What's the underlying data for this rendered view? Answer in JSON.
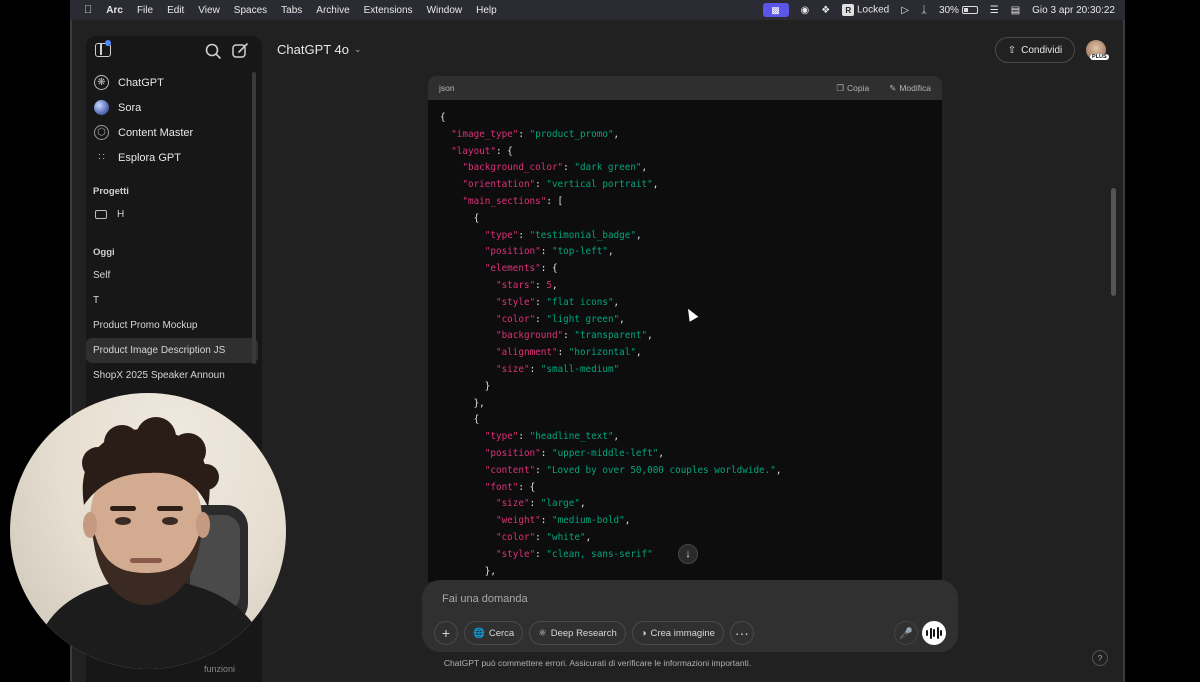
{
  "menubar": {
    "apple": "",
    "app": "Arc",
    "menus": [
      "File",
      "Edit",
      "View",
      "Spaces",
      "Tabs",
      "Archive",
      "Extensions",
      "Window",
      "Help"
    ],
    "status": {
      "locked": "Locked",
      "battery": "30%",
      "datetime": "Gio 3 apr  20:30:22",
      "r_badge": "R"
    }
  },
  "header": {
    "model": "ChatGPT 4o",
    "share": "Condividi",
    "plan_badge": "PLUS"
  },
  "sidebar": {
    "gpts": [
      {
        "label": "ChatGPT",
        "icon": "chatgpt-icon"
      },
      {
        "label": "Sora",
        "icon": "sora-icon"
      },
      {
        "label": "Content Master",
        "icon": "content-master-icon"
      },
      {
        "label": "Esplora GPT",
        "icon": "explore-grid-icon"
      }
    ],
    "projects_heading": "Progetti",
    "projects": [
      {
        "label": "H"
      }
    ],
    "today_heading": "Oggi",
    "chats": [
      {
        "label": "Self"
      },
      {
        "label": "T"
      },
      {
        "label": "Product Promo Mockup"
      },
      {
        "label": "Product Image Description JS"
      },
      {
        "label": "ShopX 2025 Speaker Announ"
      }
    ],
    "footer": "funzioni"
  },
  "code_block": {
    "lang": "json",
    "copy": "Copia",
    "edit": "Modifica",
    "lines": [
      [
        {
          "t": "{",
          "c": "p"
        }
      ],
      [
        {
          "t": "  ",
          "c": "p"
        },
        {
          "t": "\"image_type\"",
          "c": "k"
        },
        {
          "t": ": ",
          "c": "p"
        },
        {
          "t": "\"product_promo\"",
          "c": "s"
        },
        {
          "t": ",",
          "c": "p"
        }
      ],
      [
        {
          "t": "  ",
          "c": "p"
        },
        {
          "t": "\"layout\"",
          "c": "k"
        },
        {
          "t": ": {",
          "c": "p"
        }
      ],
      [
        {
          "t": "    ",
          "c": "p"
        },
        {
          "t": "\"background_color\"",
          "c": "k"
        },
        {
          "t": ": ",
          "c": "p"
        },
        {
          "t": "\"dark green\"",
          "c": "s"
        },
        {
          "t": ",",
          "c": "p"
        }
      ],
      [
        {
          "t": "    ",
          "c": "p"
        },
        {
          "t": "\"orientation\"",
          "c": "k"
        },
        {
          "t": ": ",
          "c": "p"
        },
        {
          "t": "\"vertical portrait\"",
          "c": "s"
        },
        {
          "t": ",",
          "c": "p"
        }
      ],
      [
        {
          "t": "    ",
          "c": "p"
        },
        {
          "t": "\"main_sections\"",
          "c": "k"
        },
        {
          "t": ": [",
          "c": "p"
        }
      ],
      [
        {
          "t": "      {",
          "c": "p"
        }
      ],
      [
        {
          "t": "        ",
          "c": "p"
        },
        {
          "t": "\"type\"",
          "c": "k"
        },
        {
          "t": ": ",
          "c": "p"
        },
        {
          "t": "\"testimonial_badge\"",
          "c": "s"
        },
        {
          "t": ",",
          "c": "p"
        }
      ],
      [
        {
          "t": "        ",
          "c": "p"
        },
        {
          "t": "\"position\"",
          "c": "k"
        },
        {
          "t": ": ",
          "c": "p"
        },
        {
          "t": "\"top-left\"",
          "c": "s"
        },
        {
          "t": ",",
          "c": "p"
        }
      ],
      [
        {
          "t": "        ",
          "c": "p"
        },
        {
          "t": "\"elements\"",
          "c": "k"
        },
        {
          "t": ": {",
          "c": "p"
        }
      ],
      [
        {
          "t": "          ",
          "c": "p"
        },
        {
          "t": "\"stars\"",
          "c": "k"
        },
        {
          "t": ": ",
          "c": "p"
        },
        {
          "t": "5",
          "c": "n"
        },
        {
          "t": ",",
          "c": "p"
        }
      ],
      [
        {
          "t": "          ",
          "c": "p"
        },
        {
          "t": "\"style\"",
          "c": "k"
        },
        {
          "t": ": ",
          "c": "p"
        },
        {
          "t": "\"flat icons\"",
          "c": "s"
        },
        {
          "t": ",",
          "c": "p"
        }
      ],
      [
        {
          "t": "          ",
          "c": "p"
        },
        {
          "t": "\"color\"",
          "c": "k"
        },
        {
          "t": ": ",
          "c": "p"
        },
        {
          "t": "\"light green\"",
          "c": "s"
        },
        {
          "t": ",",
          "c": "p"
        }
      ],
      [
        {
          "t": "          ",
          "c": "p"
        },
        {
          "t": "\"background\"",
          "c": "k"
        },
        {
          "t": ": ",
          "c": "p"
        },
        {
          "t": "\"transparent\"",
          "c": "s"
        },
        {
          "t": ",",
          "c": "p"
        }
      ],
      [
        {
          "t": "          ",
          "c": "p"
        },
        {
          "t": "\"alignment\"",
          "c": "k"
        },
        {
          "t": ": ",
          "c": "p"
        },
        {
          "t": "\"horizontal\"",
          "c": "s"
        },
        {
          "t": ",",
          "c": "p"
        }
      ],
      [
        {
          "t": "          ",
          "c": "p"
        },
        {
          "t": "\"size\"",
          "c": "k"
        },
        {
          "t": ": ",
          "c": "p"
        },
        {
          "t": "\"small-medium\"",
          "c": "s"
        }
      ],
      [
        {
          "t": "        }",
          "c": "p"
        }
      ],
      [
        {
          "t": "      },",
          "c": "p"
        }
      ],
      [
        {
          "t": "      {",
          "c": "p"
        }
      ],
      [
        {
          "t": "        ",
          "c": "p"
        },
        {
          "t": "\"type\"",
          "c": "k"
        },
        {
          "t": ": ",
          "c": "p"
        },
        {
          "t": "\"headline_text\"",
          "c": "s"
        },
        {
          "t": ",",
          "c": "p"
        }
      ],
      [
        {
          "t": "        ",
          "c": "p"
        },
        {
          "t": "\"position\"",
          "c": "k"
        },
        {
          "t": ": ",
          "c": "p"
        },
        {
          "t": "\"upper-middle-left\"",
          "c": "s"
        },
        {
          "t": ",",
          "c": "p"
        }
      ],
      [
        {
          "t": "        ",
          "c": "p"
        },
        {
          "t": "\"content\"",
          "c": "k"
        },
        {
          "t": ": ",
          "c": "p"
        },
        {
          "t": "\"Loved by over 50,000 couples worldwide.\"",
          "c": "s"
        },
        {
          "t": ",",
          "c": "p"
        }
      ],
      [
        {
          "t": "        ",
          "c": "p"
        },
        {
          "t": "\"font\"",
          "c": "k"
        },
        {
          "t": ": {",
          "c": "p"
        }
      ],
      [
        {
          "t": "          ",
          "c": "p"
        },
        {
          "t": "\"size\"",
          "c": "k"
        },
        {
          "t": ": ",
          "c": "p"
        },
        {
          "t": "\"large\"",
          "c": "s"
        },
        {
          "t": ",",
          "c": "p"
        }
      ],
      [
        {
          "t": "          ",
          "c": "p"
        },
        {
          "t": "\"weight\"",
          "c": "k"
        },
        {
          "t": ": ",
          "c": "p"
        },
        {
          "t": "\"medium-bold\"",
          "c": "s"
        },
        {
          "t": ",",
          "c": "p"
        }
      ],
      [
        {
          "t": "          ",
          "c": "p"
        },
        {
          "t": "\"color\"",
          "c": "k"
        },
        {
          "t": ": ",
          "c": "p"
        },
        {
          "t": "\"white\"",
          "c": "s"
        },
        {
          "t": ",",
          "c": "p"
        }
      ],
      [
        {
          "t": "          ",
          "c": "p"
        },
        {
          "t": "\"style\"",
          "c": "k"
        },
        {
          "t": ": ",
          "c": "p"
        },
        {
          "t": "\"clean, sans-serif\"",
          "c": "s"
        }
      ],
      [
        {
          "t": "        },",
          "c": "p"
        }
      ]
    ]
  },
  "composer": {
    "placeholder": "Fai una domanda",
    "tools": {
      "search": "Cerca",
      "deep_research": "Deep Research",
      "create_image": "Crea immagine",
      "more": "···",
      "add": "+"
    }
  },
  "disclaimer": "ChatGPT può commettere errori. Assicurati di verificare le informazioni importanti.",
  "help": "?",
  "colors": {
    "window_bg": "#212121",
    "sidebar_bg": "#171717",
    "code_bg": "#0d0d0d",
    "json_key": "#df3079",
    "json_string": "#00a67d",
    "arc_indicator": "#5b55e8"
  }
}
